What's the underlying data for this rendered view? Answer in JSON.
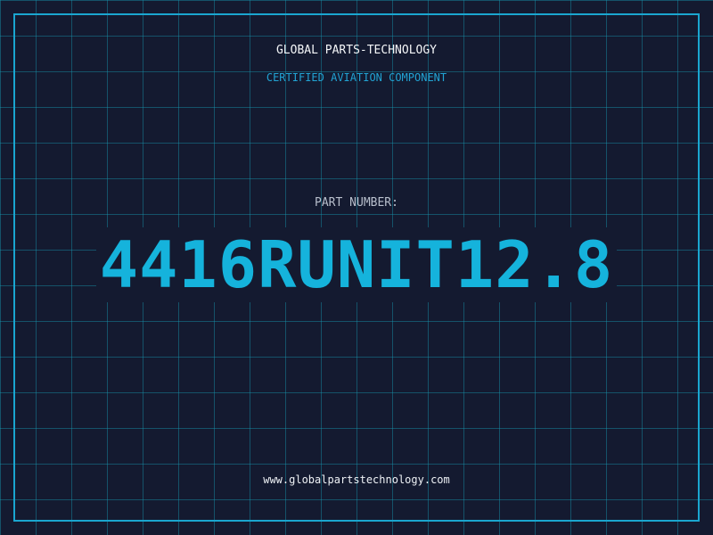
{
  "header": {
    "title": "GLOBAL PARTS-TECHNOLOGY",
    "subtitle": "CERTIFIED AVIATION COMPONENT"
  },
  "part": {
    "label": "PART NUMBER:",
    "number": "4416RUNIT12.8"
  },
  "footer": {
    "website": "www.globalpartstechnology.com"
  },
  "colors": {
    "background": "#141a30",
    "grid": "#1696af",
    "accent": "#15b3dc",
    "frame": "#1aa6d0"
  }
}
